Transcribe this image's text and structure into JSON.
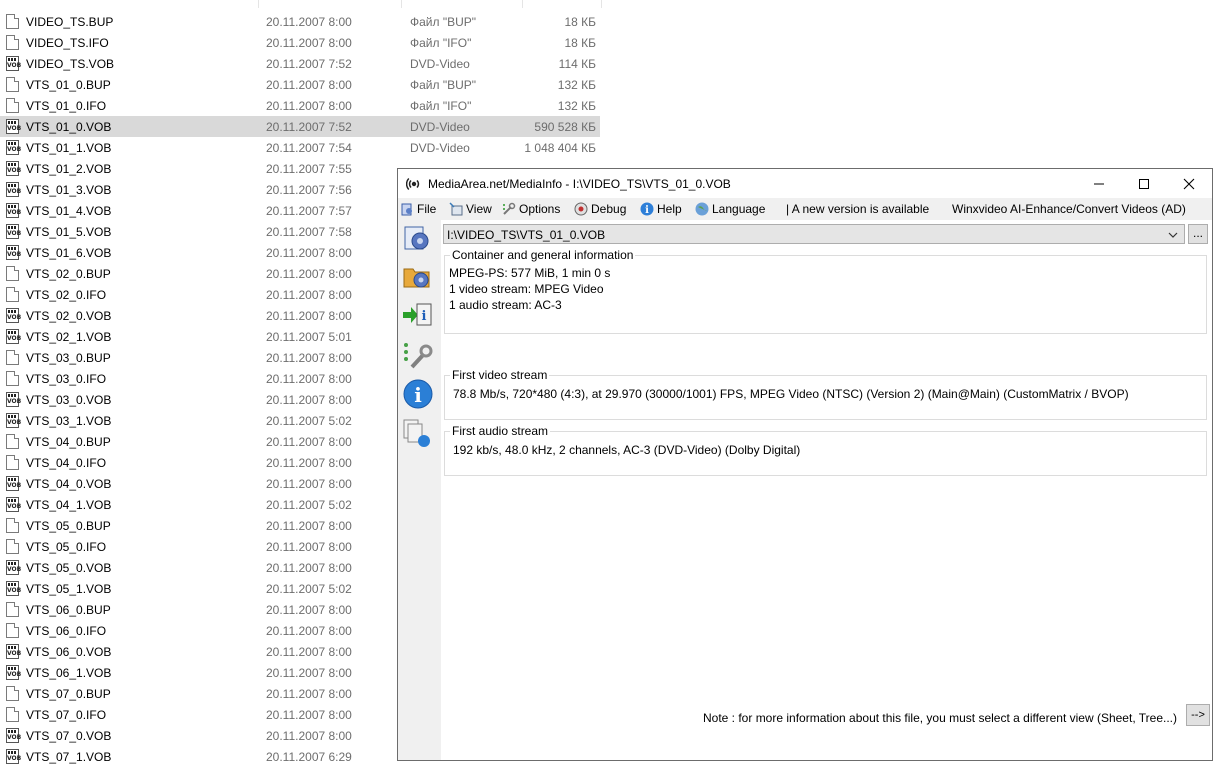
{
  "explorer": {
    "partial_header_size": "",
    "files": [
      {
        "name": "VIDEO_TS.BUP",
        "date": "20.11.2007 8:00",
        "type": "Файл \"BUP\"",
        "size": "18 КБ",
        "icon": "file-icon"
      },
      {
        "name": "VIDEO_TS.IFO",
        "date": "20.11.2007 8:00",
        "type": "Файл \"IFO\"",
        "size": "18 КБ",
        "icon": "file-icon"
      },
      {
        "name": "VIDEO_TS.VOB",
        "date": "20.11.2007 7:52",
        "type": "DVD-Video",
        "size": "114 КБ",
        "icon": "vob-file-icon"
      },
      {
        "name": "VTS_01_0.BUP",
        "date": "20.11.2007 8:00",
        "type": "Файл \"BUP\"",
        "size": "132 КБ",
        "icon": "file-icon"
      },
      {
        "name": "VTS_01_0.IFO",
        "date": "20.11.2007 8:00",
        "type": "Файл \"IFO\"",
        "size": "132 КБ",
        "icon": "file-icon"
      },
      {
        "name": "VTS_01_0.VOB",
        "date": "20.11.2007 7:52",
        "type": "DVD-Video",
        "size": "590 528 КБ",
        "icon": "vob-file-icon",
        "selected": true
      },
      {
        "name": "VTS_01_1.VOB",
        "date": "20.11.2007 7:54",
        "type": "DVD-Video",
        "size": "1 048 404 КБ",
        "icon": "vob-file-icon"
      },
      {
        "name": "VTS_01_2.VOB",
        "date": "20.11.2007 7:55",
        "type": "",
        "size": "",
        "icon": "vob-file-icon"
      },
      {
        "name": "VTS_01_3.VOB",
        "date": "20.11.2007 7:56",
        "type": "",
        "size": "",
        "icon": "vob-file-icon"
      },
      {
        "name": "VTS_01_4.VOB",
        "date": "20.11.2007 7:57",
        "type": "",
        "size": "",
        "icon": "vob-file-icon"
      },
      {
        "name": "VTS_01_5.VOB",
        "date": "20.11.2007 7:58",
        "type": "",
        "size": "",
        "icon": "vob-file-icon"
      },
      {
        "name": "VTS_01_6.VOB",
        "date": "20.11.2007 8:00",
        "type": "",
        "size": "",
        "icon": "vob-file-icon"
      },
      {
        "name": "VTS_02_0.BUP",
        "date": "20.11.2007 8:00",
        "type": "",
        "size": "",
        "icon": "file-icon"
      },
      {
        "name": "VTS_02_0.IFO",
        "date": "20.11.2007 8:00",
        "type": "",
        "size": "",
        "icon": "file-icon"
      },
      {
        "name": "VTS_02_0.VOB",
        "date": "20.11.2007 8:00",
        "type": "",
        "size": "",
        "icon": "vob-file-icon"
      },
      {
        "name": "VTS_02_1.VOB",
        "date": "20.11.2007 5:01",
        "type": "",
        "size": "",
        "icon": "vob-file-icon"
      },
      {
        "name": "VTS_03_0.BUP",
        "date": "20.11.2007 8:00",
        "type": "",
        "size": "",
        "icon": "file-icon"
      },
      {
        "name": "VTS_03_0.IFO",
        "date": "20.11.2007 8:00",
        "type": "",
        "size": "",
        "icon": "file-icon"
      },
      {
        "name": "VTS_03_0.VOB",
        "date": "20.11.2007 8:00",
        "type": "",
        "size": "",
        "icon": "vob-file-icon"
      },
      {
        "name": "VTS_03_1.VOB",
        "date": "20.11.2007 5:02",
        "type": "",
        "size": "",
        "icon": "vob-file-icon"
      },
      {
        "name": "VTS_04_0.BUP",
        "date": "20.11.2007 8:00",
        "type": "",
        "size": "",
        "icon": "file-icon"
      },
      {
        "name": "VTS_04_0.IFO",
        "date": "20.11.2007 8:00",
        "type": "",
        "size": "",
        "icon": "file-icon"
      },
      {
        "name": "VTS_04_0.VOB",
        "date": "20.11.2007 8:00",
        "type": "",
        "size": "",
        "icon": "vob-file-icon"
      },
      {
        "name": "VTS_04_1.VOB",
        "date": "20.11.2007 5:02",
        "type": "",
        "size": "",
        "icon": "vob-file-icon"
      },
      {
        "name": "VTS_05_0.BUP",
        "date": "20.11.2007 8:00",
        "type": "",
        "size": "",
        "icon": "file-icon"
      },
      {
        "name": "VTS_05_0.IFO",
        "date": "20.11.2007 8:00",
        "type": "",
        "size": "",
        "icon": "file-icon"
      },
      {
        "name": "VTS_05_0.VOB",
        "date": "20.11.2007 8:00",
        "type": "",
        "size": "",
        "icon": "vob-file-icon"
      },
      {
        "name": "VTS_05_1.VOB",
        "date": "20.11.2007 5:02",
        "type": "",
        "size": "",
        "icon": "vob-file-icon"
      },
      {
        "name": "VTS_06_0.BUP",
        "date": "20.11.2007 8:00",
        "type": "",
        "size": "",
        "icon": "file-icon"
      },
      {
        "name": "VTS_06_0.IFO",
        "date": "20.11.2007 8:00",
        "type": "",
        "size": "",
        "icon": "file-icon"
      },
      {
        "name": "VTS_06_0.VOB",
        "date": "20.11.2007 8:00",
        "type": "",
        "size": "",
        "icon": "vob-file-icon"
      },
      {
        "name": "VTS_06_1.VOB",
        "date": "20.11.2007 8:00",
        "type": "",
        "size": "",
        "icon": "vob-file-icon"
      },
      {
        "name": "VTS_07_0.BUP",
        "date": "20.11.2007 8:00",
        "type": "",
        "size": "",
        "icon": "file-icon"
      },
      {
        "name": "VTS_07_0.IFO",
        "date": "20.11.2007 8:00",
        "type": "",
        "size": "",
        "icon": "file-icon"
      },
      {
        "name": "VTS_07_0.VOB",
        "date": "20.11.2007 8:00",
        "type": "",
        "size": "",
        "icon": "vob-file-icon"
      },
      {
        "name": "VTS_07_1.VOB",
        "date": "20.11.2007 6:29",
        "type": "",
        "size": "",
        "icon": "vob-file-icon"
      }
    ]
  },
  "mediainfo": {
    "title": "MediaArea.net/MediaInfo - I:\\VIDEO_TS\\VTS_01_0.VOB",
    "menu": {
      "file": "File",
      "view": "View",
      "options": "Options",
      "debug": "Debug",
      "help": "Help",
      "language": "Language",
      "new_version": "| A new version is available",
      "ad": "Winxvideo AI-Enhance/Convert Videos (AD)"
    },
    "toolbar_icons": [
      "open-file-icon",
      "open-folder-icon",
      "export-icon",
      "preferences-icon",
      "about-icon",
      "files-info-icon"
    ],
    "file_select": {
      "value": "I:\\VIDEO_TS\\VTS_01_0.VOB",
      "browse": "..."
    },
    "general": {
      "title": "Container and general information",
      "lines": [
        "MPEG-PS: 577 MiB, 1 min 0 s",
        "1 video stream: MPEG Video",
        "1 audio stream: AC-3"
      ]
    },
    "video": {
      "title": "First video stream",
      "line": "78.8 Mb/s, 720*480 (4:3), at 29.970 (30000/1001) FPS, MPEG Video (NTSC) (Version 2) (Main@Main) (CustomMatrix / BVOP)"
    },
    "audio": {
      "title": "First audio stream",
      "line": "192 kb/s, 48.0 kHz, 2 channels, AC-3 (DVD-Video) (Dolby Digital)"
    },
    "note": "Note : for more information about this file, you must select a different view (Sheet, Tree...)",
    "more_button": "-->"
  },
  "colors": {
    "selected_row": "#d9d9d9",
    "secondary_text": "#6d6d6d"
  }
}
